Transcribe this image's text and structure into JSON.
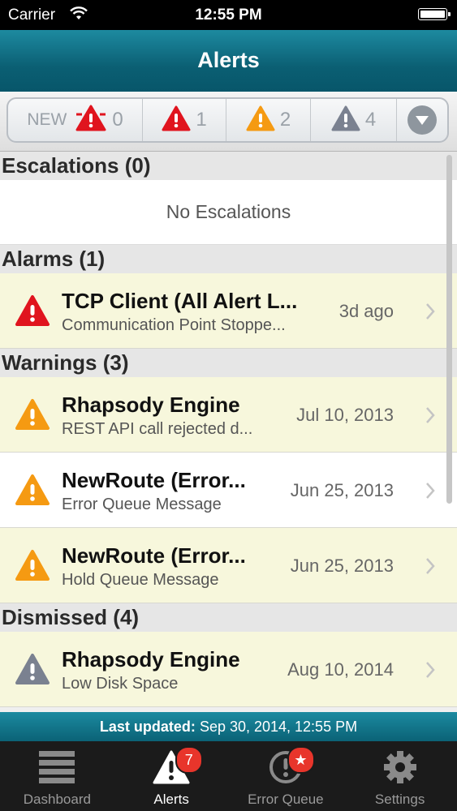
{
  "status_bar": {
    "carrier": "Carrier",
    "time": "12:55 PM"
  },
  "nav": {
    "title": "Alerts"
  },
  "filter": {
    "new_label": "NEW",
    "segments": [
      {
        "icon": "new-alarm-icon",
        "count": "0"
      },
      {
        "icon": "alarm-icon",
        "count": "1"
      },
      {
        "icon": "warning-icon",
        "count": "2"
      },
      {
        "icon": "dismissed-icon",
        "count": "4"
      }
    ]
  },
  "sections": {
    "escalations": {
      "title": "Escalations (0)",
      "empty": "No Escalations"
    },
    "alarms": {
      "title": "Alarms (1)",
      "rows": [
        {
          "name": "TCP Client (All Alert L...",
          "sub": "Communication Point Stoppe...",
          "date": "3d ago"
        }
      ]
    },
    "warnings": {
      "title": "Warnings (3)",
      "rows": [
        {
          "name": "Rhapsody Engine",
          "sub": "REST API call rejected d...",
          "date": "Jul 10, 2013"
        },
        {
          "name": "NewRoute (Error...",
          "sub": "Error Queue Message",
          "date": "Jun 25, 2013"
        },
        {
          "name": "NewRoute (Error...",
          "sub": "Hold Queue Message",
          "date": "Jun 25, 2013"
        }
      ]
    },
    "dismissed": {
      "title": "Dismissed (4)",
      "rows": [
        {
          "name": "Rhapsody Engine",
          "sub": "Low Disk Space",
          "date": "Aug 10, 2014"
        }
      ]
    }
  },
  "updated": {
    "label": "Last updated:",
    "value": "Sep 30, 2014, 12:55 PM"
  },
  "tabs": [
    {
      "label": "Dashboard",
      "icon": "dashboard-icon"
    },
    {
      "label": "Alerts",
      "icon": "alert-tab-icon",
      "badge": "7"
    },
    {
      "label": "Error Queue",
      "icon": "error-queue-icon",
      "badge": "★"
    },
    {
      "label": "Settings",
      "icon": "gear-icon"
    }
  ],
  "colors": {
    "alarm": "#e0141e",
    "warning": "#f59a12",
    "dismissed": "#7a8190",
    "teal": "#0b6276",
    "badge": "#e8352b"
  }
}
